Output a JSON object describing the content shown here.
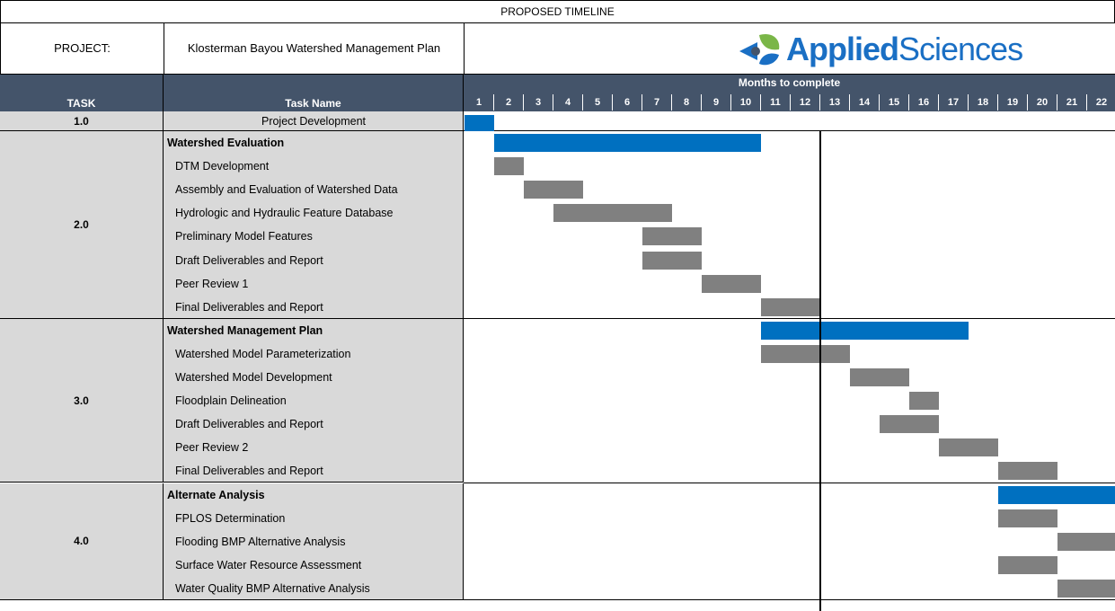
{
  "title": "PROPOSED TIMELINE",
  "project_label": "PROJECT:",
  "project_name": "Klosterman Bayou Watershed Management Plan",
  "logo": {
    "text_bold": "Applied",
    "text_regular": "Sciences",
    "icon": "leaf-drop-logo-icon"
  },
  "header": {
    "task": "TASK",
    "task_name": "Task Name",
    "months": "Months to complete"
  },
  "colors": {
    "header_bg": "#44546a",
    "phase_bar": "#0070c0",
    "task_bar": "#808080",
    "label_bg": "#d9d9d9"
  },
  "chart_data": {
    "type": "gantt",
    "title": "PROPOSED TIMELINE",
    "x_axis_label": "Months to complete",
    "months": [
      "1",
      "2",
      "3",
      "4",
      "5",
      "6",
      "7",
      "8",
      "9",
      "10",
      "11",
      "12",
      "13",
      "14",
      "15",
      "16",
      "17",
      "18",
      "19",
      "20",
      "21",
      "22"
    ],
    "groups": [
      {
        "task": "1.0",
        "rows": [
          {
            "name": "Project Development",
            "kind": "phase",
            "start": 1,
            "end": 1
          }
        ]
      },
      {
        "task": "2.0",
        "rows": [
          {
            "name": "Watershed Evaluation",
            "kind": "phase",
            "start": 2,
            "end": 10
          },
          {
            "name": "DTM Development",
            "kind": "task",
            "start": 2,
            "end": 2
          },
          {
            "name": "Assembly and Evaluation of Watershed Data",
            "kind": "task",
            "start": 3,
            "end": 4
          },
          {
            "name": "Hydrologic and Hydraulic Feature Database",
            "kind": "task",
            "start": 4,
            "end": 7
          },
          {
            "name": "Preliminary Model Features",
            "kind": "task",
            "start": 7,
            "end": 8
          },
          {
            "name": "Draft Deliverables and Report",
            "kind": "task",
            "start": 7,
            "end": 8
          },
          {
            "name": "Peer Review 1",
            "kind": "task",
            "start": 9,
            "end": 10
          },
          {
            "name": "Final Deliverables and Report",
            "kind": "task",
            "start": 11,
            "end": 12
          }
        ]
      },
      {
        "task": "3.0",
        "rows": [
          {
            "name": "Watershed Management Plan",
            "kind": "phase",
            "start": 11,
            "end": 17
          },
          {
            "name": "Watershed Model Parameterization",
            "kind": "task",
            "start": 11,
            "end": 13
          },
          {
            "name": "Watershed Model Development",
            "kind": "task",
            "start": 14,
            "end": 15
          },
          {
            "name": "Floodplain Delineation",
            "kind": "task",
            "start": 16,
            "end": 16
          },
          {
            "name": "Draft Deliverables and Report",
            "kind": "task",
            "start": 15,
            "end": 16
          },
          {
            "name": "Peer Review 2",
            "kind": "task",
            "start": 17,
            "end": 18
          },
          {
            "name": "Final Deliverables and Report",
            "kind": "task",
            "start": 19,
            "end": 20
          }
        ]
      },
      {
        "task": "4.0",
        "rows": [
          {
            "name": "Alternate Analysis",
            "kind": "phase",
            "start": 19,
            "end": 22
          },
          {
            "name": "FPLOS Determination",
            "kind": "task",
            "start": 19,
            "end": 20
          },
          {
            "name": "Flooding BMP Alternative Analysis",
            "kind": "task",
            "start": 21,
            "end": 22
          },
          {
            "name": "Surface Water Resource Assessment",
            "kind": "task",
            "start": 19,
            "end": 20
          },
          {
            "name": "Water Quality BMP Alternative Analysis",
            "kind": "task",
            "start": 21,
            "end": 22
          }
        ]
      }
    ],
    "marker_after_month": 12
  }
}
